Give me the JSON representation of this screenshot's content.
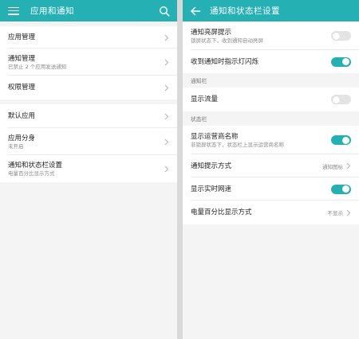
{
  "colors": {
    "accent": "#25b0b4",
    "background": "#f4f4f4"
  },
  "left": {
    "title": "应用和通知",
    "menu_icon": "hamburger-menu-icon",
    "search_icon": "search-icon",
    "group1": [
      {
        "title": "应用管理"
      },
      {
        "title": "通知管理",
        "subtitle": "已禁止 2 个应用发送通知"
      },
      {
        "title": "权限管理"
      }
    ],
    "group2": [
      {
        "title": "默认应用"
      },
      {
        "title": "应用分身",
        "subtitle": "未开启"
      },
      {
        "title": "通知和状态栏设置",
        "subtitle": "电量百分比显示方式"
      }
    ]
  },
  "right": {
    "title": "通知和状态栏设置",
    "back_icon": "back-arrow-icon",
    "group1": [
      {
        "title": "通知亮屏提示",
        "subtitle": "锁屏状态下，收到通知自动亮屏",
        "toggle": false
      },
      {
        "title": "收到通知时指示灯闪烁",
        "toggle": true
      }
    ],
    "section_notify": "通知栏",
    "group2": [
      {
        "title": "显示流量",
        "toggle": false
      }
    ],
    "section_status": "状态栏",
    "group3": [
      {
        "title": "显示运营商名称",
        "subtitle": "非锁屏状态下，状态栏上显示运营商名称",
        "toggle": true
      },
      {
        "title": "通知提示方式",
        "value": "通知图标"
      },
      {
        "title": "显示实时网速",
        "toggle": true
      },
      {
        "title": "电量百分比显示方式",
        "value": "不显示"
      }
    ]
  }
}
